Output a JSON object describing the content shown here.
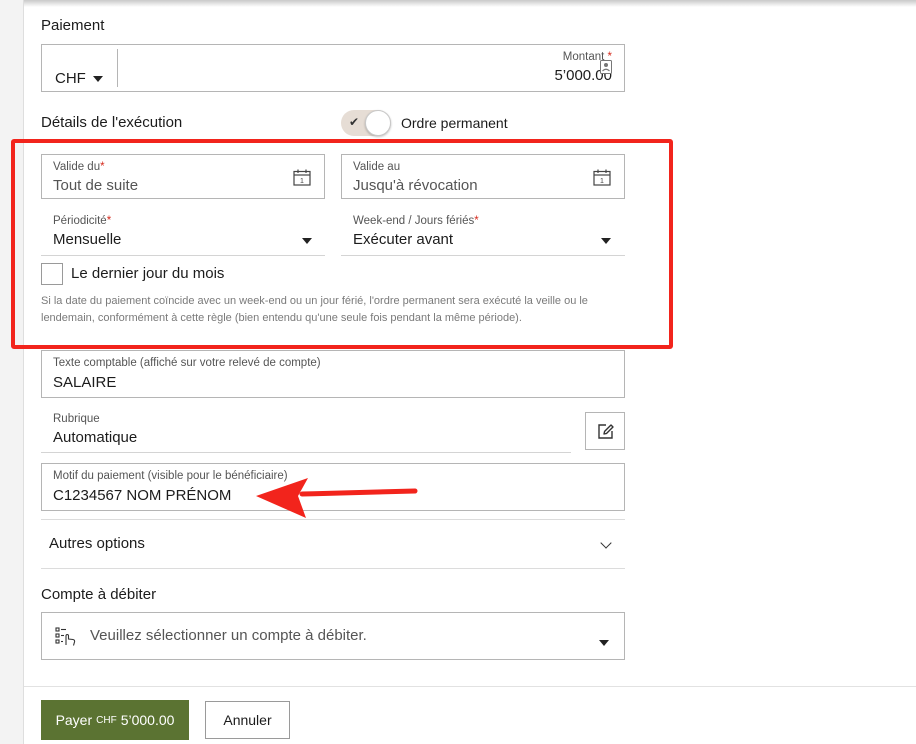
{
  "payment": {
    "section_title": "Paiement",
    "currency": "CHF",
    "amount_label": "Montant",
    "amount_value": "5’000.00"
  },
  "execution": {
    "section_title": "Détails de l'exécution",
    "standing_order_label": "Ordre permanent",
    "valid_from_label": "Valide du",
    "valid_from_value": "Tout de suite",
    "valid_to_label": "Valide au",
    "valid_to_placeholder": "Jusqu'à révocation",
    "periodicity_label": "Périodicité",
    "periodicity_value": "Mensuelle",
    "weekend_label": "Week-end / Jours fériés",
    "weekend_value": "Exécuter avant",
    "last_day_label": "Le dernier jour du mois",
    "hint_text": "Si la date du paiement coïncide avec un week-end ou un jour férié, l'ordre permanent sera exécuté la veille ou le lendemain, conformément à cette règle (bien entendu qu'une seule fois pendant la même période)."
  },
  "booking": {
    "label": "Texte comptable (affiché sur votre relevé de compte)",
    "value": "SALAIRE"
  },
  "category": {
    "label": "Rubrique",
    "value": "Automatique"
  },
  "reference": {
    "label": "Motif du paiement (visible pour le bénéficiaire)",
    "value": "C1234567 NOM PRÉNOM"
  },
  "more_options": {
    "label": "Autres options"
  },
  "debit": {
    "section_title": "Compte à débiter",
    "placeholder": "Veuillez sélectionner un compte à débiter."
  },
  "footer": {
    "pay_label": "Payer",
    "pay_currency": "CHF",
    "pay_amount": "5’000.00",
    "cancel_label": "Annuler"
  },
  "colors": {
    "accent_green": "#5b7332",
    "annotation_red": "#f2241c",
    "required_red": "#d52b1e"
  },
  "icons": [
    "calendar-icon",
    "caret-down-icon",
    "check-icon",
    "edit-icon",
    "chevron-down-icon",
    "account-select-icon",
    "contact-icon",
    "arrow-annotation"
  ]
}
